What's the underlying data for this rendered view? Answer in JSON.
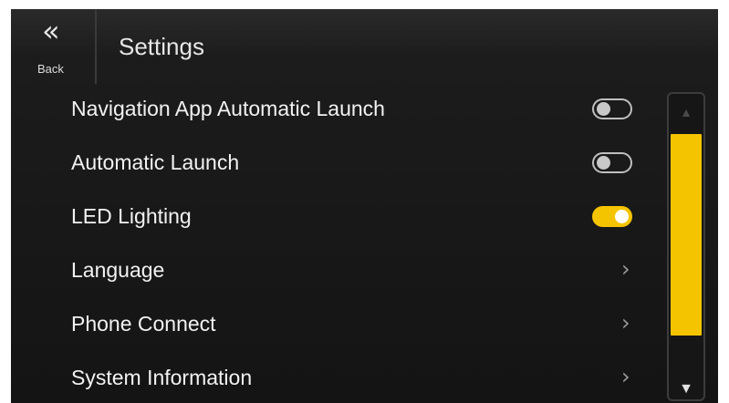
{
  "header": {
    "back_icon": "«",
    "back_label": "Back",
    "title": "Settings"
  },
  "settings": [
    {
      "label": "Navigation App Automatic Launch",
      "control": "toggle",
      "enabled": false
    },
    {
      "label": "Automatic Launch",
      "control": "toggle",
      "enabled": false
    },
    {
      "label": "LED Lighting",
      "control": "toggle",
      "enabled": true
    },
    {
      "label": "Language",
      "control": "chevron"
    },
    {
      "label": "Phone Connect",
      "control": "chevron"
    },
    {
      "label": "System Information",
      "control": "chevron"
    }
  ],
  "chevron_glyph": "›",
  "scrollbar": {
    "up_glyph": "▲",
    "down_glyph": "▼",
    "thumb_start_fraction": 0.13,
    "thumb_size_fraction": 0.66
  },
  "colors": {
    "accent": "#f5c400",
    "background": "#141414",
    "text": "#f2f2f2"
  },
  "icons": {
    "back": "double-chevron-left-icon",
    "chevron": "chevron-right-icon",
    "scroll_up": "triangle-up-icon",
    "scroll_down": "triangle-down-icon"
  }
}
